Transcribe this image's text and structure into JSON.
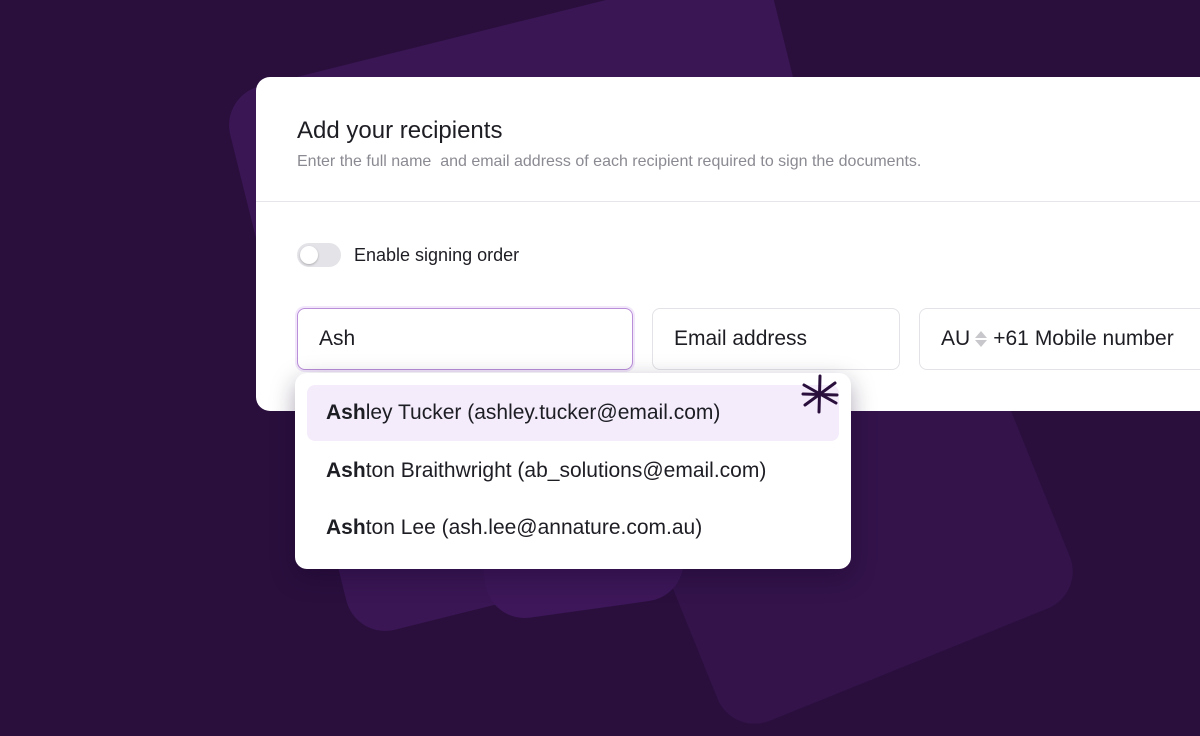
{
  "form": {
    "title": "Add your recipients",
    "subtitle": "Enter the full name  and email address of each recipient required to sign the documents.",
    "toggle": {
      "label": "Enable signing order",
      "enabled": false
    },
    "name_field": {
      "value": "Ash"
    },
    "email_field": {
      "placeholder": "Email address"
    },
    "phone_field": {
      "country": "AU",
      "prefix": "+61",
      "placeholder": "Mobile number"
    }
  },
  "dropdown": {
    "options": [
      {
        "match": "Ash",
        "rest": "ley Tucker (ashley.tucker@email.com)",
        "highlighted": true
      },
      {
        "match": "Ash",
        "rest": "ton Braithwright (ab_solutions@email.com)",
        "highlighted": false
      },
      {
        "match": "Ash",
        "rest": "ton Lee (ash.lee@annature.com.au)",
        "highlighted": false
      }
    ]
  },
  "colors": {
    "background": "#2a0f3d",
    "accent": "#b98fd9",
    "highlight": "#f4ecfb",
    "sparkle": "#2a0f3d"
  },
  "icons": {
    "sort_arrows": "updown-arrows-icon",
    "decoration": "sparkle-icon"
  }
}
